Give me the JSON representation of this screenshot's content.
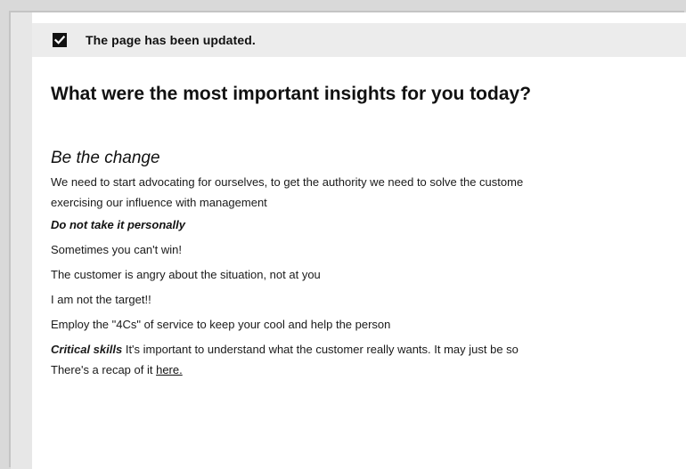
{
  "notice": {
    "text": "The page has been updated.",
    "icon": "checkbox-checked-icon"
  },
  "page_title": "What were the most important insights for you today?",
  "section": {
    "heading": "Be the change",
    "intro_line1": "We need to start advocating for ourselves, to get the authority we need to solve the custome",
    "intro_line2": "exercising our influence with management"
  },
  "personal": {
    "heading": "Do not take it personally",
    "lines": [
      "Sometimes you can't win!",
      "The customer is angry about the situation, not at you",
      "I am not the target!!",
      "Employ the \"4Cs\" of service to keep your cool and help the person"
    ]
  },
  "critical": {
    "label": "Critical skills",
    "text": " It's important to understand what the customer really wants. It may just be so",
    "recap_text": "There's a recap of it ",
    "link_label": "here."
  }
}
